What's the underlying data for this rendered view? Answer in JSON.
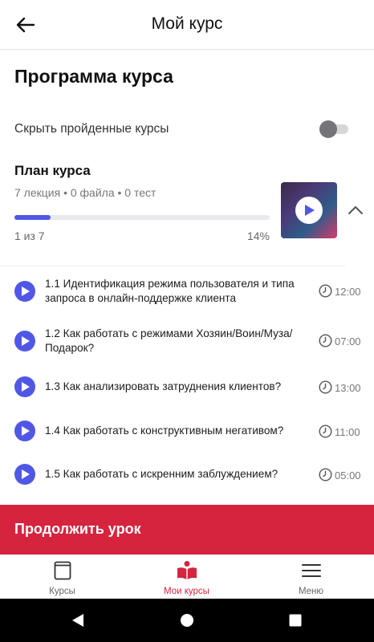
{
  "header": {
    "title": "Мой курс"
  },
  "page": {
    "section_title": "Программа курса"
  },
  "toggle": {
    "label": "Скрыть пройденные курсы",
    "enabled": false
  },
  "plan": {
    "title": "План курса",
    "meta": "7 лекция • 0 файла • 0 тест",
    "progress_left": "1 из 7",
    "progress_right": "14%",
    "progress_fraction": 0.14
  },
  "lessons": [
    {
      "title": "1.1 Идентификация режима пользователя и типа запроса в онлайн-поддержке клиента",
      "duration": "12:00"
    },
    {
      "title": "1.2 Как работать с режимами Хозяин/Воин/Муза/Подарок?",
      "duration": "07:00"
    },
    {
      "title": "1.3 Как анализировать затруднения клиентов?",
      "duration": "13:00"
    },
    {
      "title": "1.4 Как работать с конструктивным негативом?",
      "duration": "11:00"
    },
    {
      "title": "1.5 Как работать с искренним заблуждением?",
      "duration": "05:00"
    }
  ],
  "cta": {
    "label": "Продолжить урок"
  },
  "nav": {
    "items": [
      {
        "label": "Курсы",
        "icon": "book-outline-icon",
        "active": false
      },
      {
        "label": "Мои курсы",
        "icon": "reader-icon",
        "active": true
      },
      {
        "label": "Меню",
        "icon": "hamburger-menu-icon",
        "active": false
      }
    ]
  },
  "colors": {
    "accent": "#5057e6",
    "brand_red": "#d6243f"
  }
}
